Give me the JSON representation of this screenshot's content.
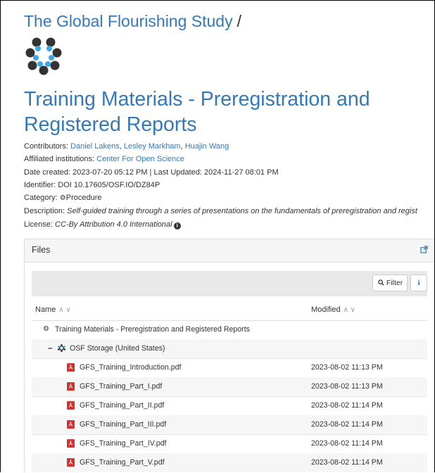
{
  "breadcrumb": {
    "parent": "The Global Flourishing Study",
    "separator": "/"
  },
  "project": {
    "title": "Training Materials - Preregistration and Registered Reports"
  },
  "meta": {
    "contributors_label": "Contributors:",
    "contributors": [
      "Daniel Lakens",
      "Lesley Markham",
      "Huajin Wang"
    ],
    "affiliated_label": "Affiliated institutions:",
    "affiliated": "Center For Open Science",
    "dates": "Date created: 2023-07-20 05:12 PM | Last Updated: 2024-11-27 08:01 PM",
    "identifier": "Identifier: DOI 10.17605/OSF.IO/DZ84P",
    "category_label": "Category:",
    "category": "Procedure",
    "description_label": "Description:",
    "description": "Self-guided training through a series of presentations on the fundamentals of preregistration and regist",
    "license_label": "License:",
    "license": "CC-By Attribution 4.0 International"
  },
  "files": {
    "panel_title": "Files",
    "filter_label": "Filter",
    "col_name": "Name",
    "col_modified": "Modified",
    "project_row": "Training Materials - Preregistration and Registered Reports",
    "storage_row": "OSF Storage (United States)",
    "items": [
      {
        "name": "GFS_Training_Introduction.pdf",
        "modified": "2023-08-02 11:13 PM"
      },
      {
        "name": "GFS_Training_Part_I.pdf",
        "modified": "2023-08-02 11:13 PM"
      },
      {
        "name": "GFS_Training_Part_II.pdf",
        "modified": "2023-08-02 11:14 PM"
      },
      {
        "name": "GFS_Training_Part_III.pdf",
        "modified": "2023-08-02 11:14 PM"
      },
      {
        "name": "GFS_Training_Part_IV.pdf",
        "modified": "2023-08-02 11:14 PM"
      },
      {
        "name": "GFS_Training_Part_V.pdf",
        "modified": "2023-08-02 11:14 PM"
      }
    ]
  },
  "colors": {
    "link": "#337ab7",
    "pdf": "#d9302c",
    "header_bg": "#f5f5f5"
  }
}
